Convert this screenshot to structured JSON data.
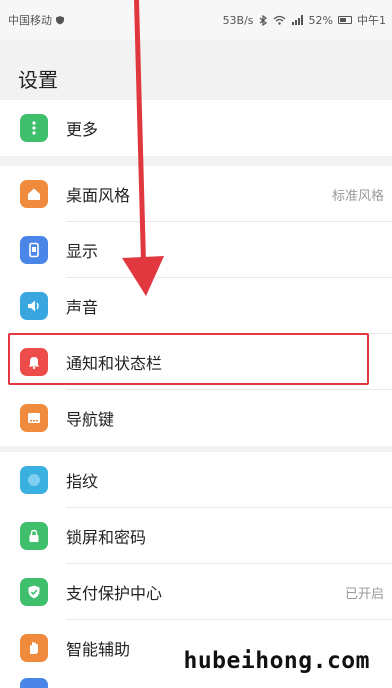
{
  "status_bar": {
    "carrier": "中国移动",
    "speed": "53B/s",
    "battery": "52%",
    "time": "中午1"
  },
  "page": {
    "title": "设置"
  },
  "groups": [
    {
      "items": [
        {
          "label": "更多",
          "icon": "more-icon",
          "color": "#3fbf6b"
        }
      ]
    },
    {
      "items": [
        {
          "label": "桌面风格",
          "value": "标准风格",
          "icon": "home-icon",
          "color": "#f08a3c"
        },
        {
          "label": "显示",
          "icon": "display-icon",
          "color": "#4a86e8"
        },
        {
          "label": "声音",
          "icon": "sound-icon",
          "color": "#3aa6e0"
        },
        {
          "label": "通知和状态栏",
          "icon": "bell-icon",
          "color": "#ee4b4b"
        },
        {
          "label": "导航键",
          "icon": "navigation-key-icon",
          "color": "#f08a3c"
        }
      ]
    },
    {
      "items": [
        {
          "label": "指纹",
          "icon": "fingerprint-icon",
          "color": "#3ab0e0"
        },
        {
          "label": "锁屏和密码",
          "icon": "lock-icon",
          "color": "#3fbf6b"
        },
        {
          "label": "支付保护中心",
          "value": "已开启",
          "icon": "shield-check-icon",
          "color": "#3fbf6b"
        },
        {
          "label": "智能辅助",
          "icon": "hand-icon",
          "color": "#f08a3c"
        }
      ]
    }
  ],
  "annotation": {
    "color": "#e0383e"
  },
  "watermark": "hubeihong.com"
}
